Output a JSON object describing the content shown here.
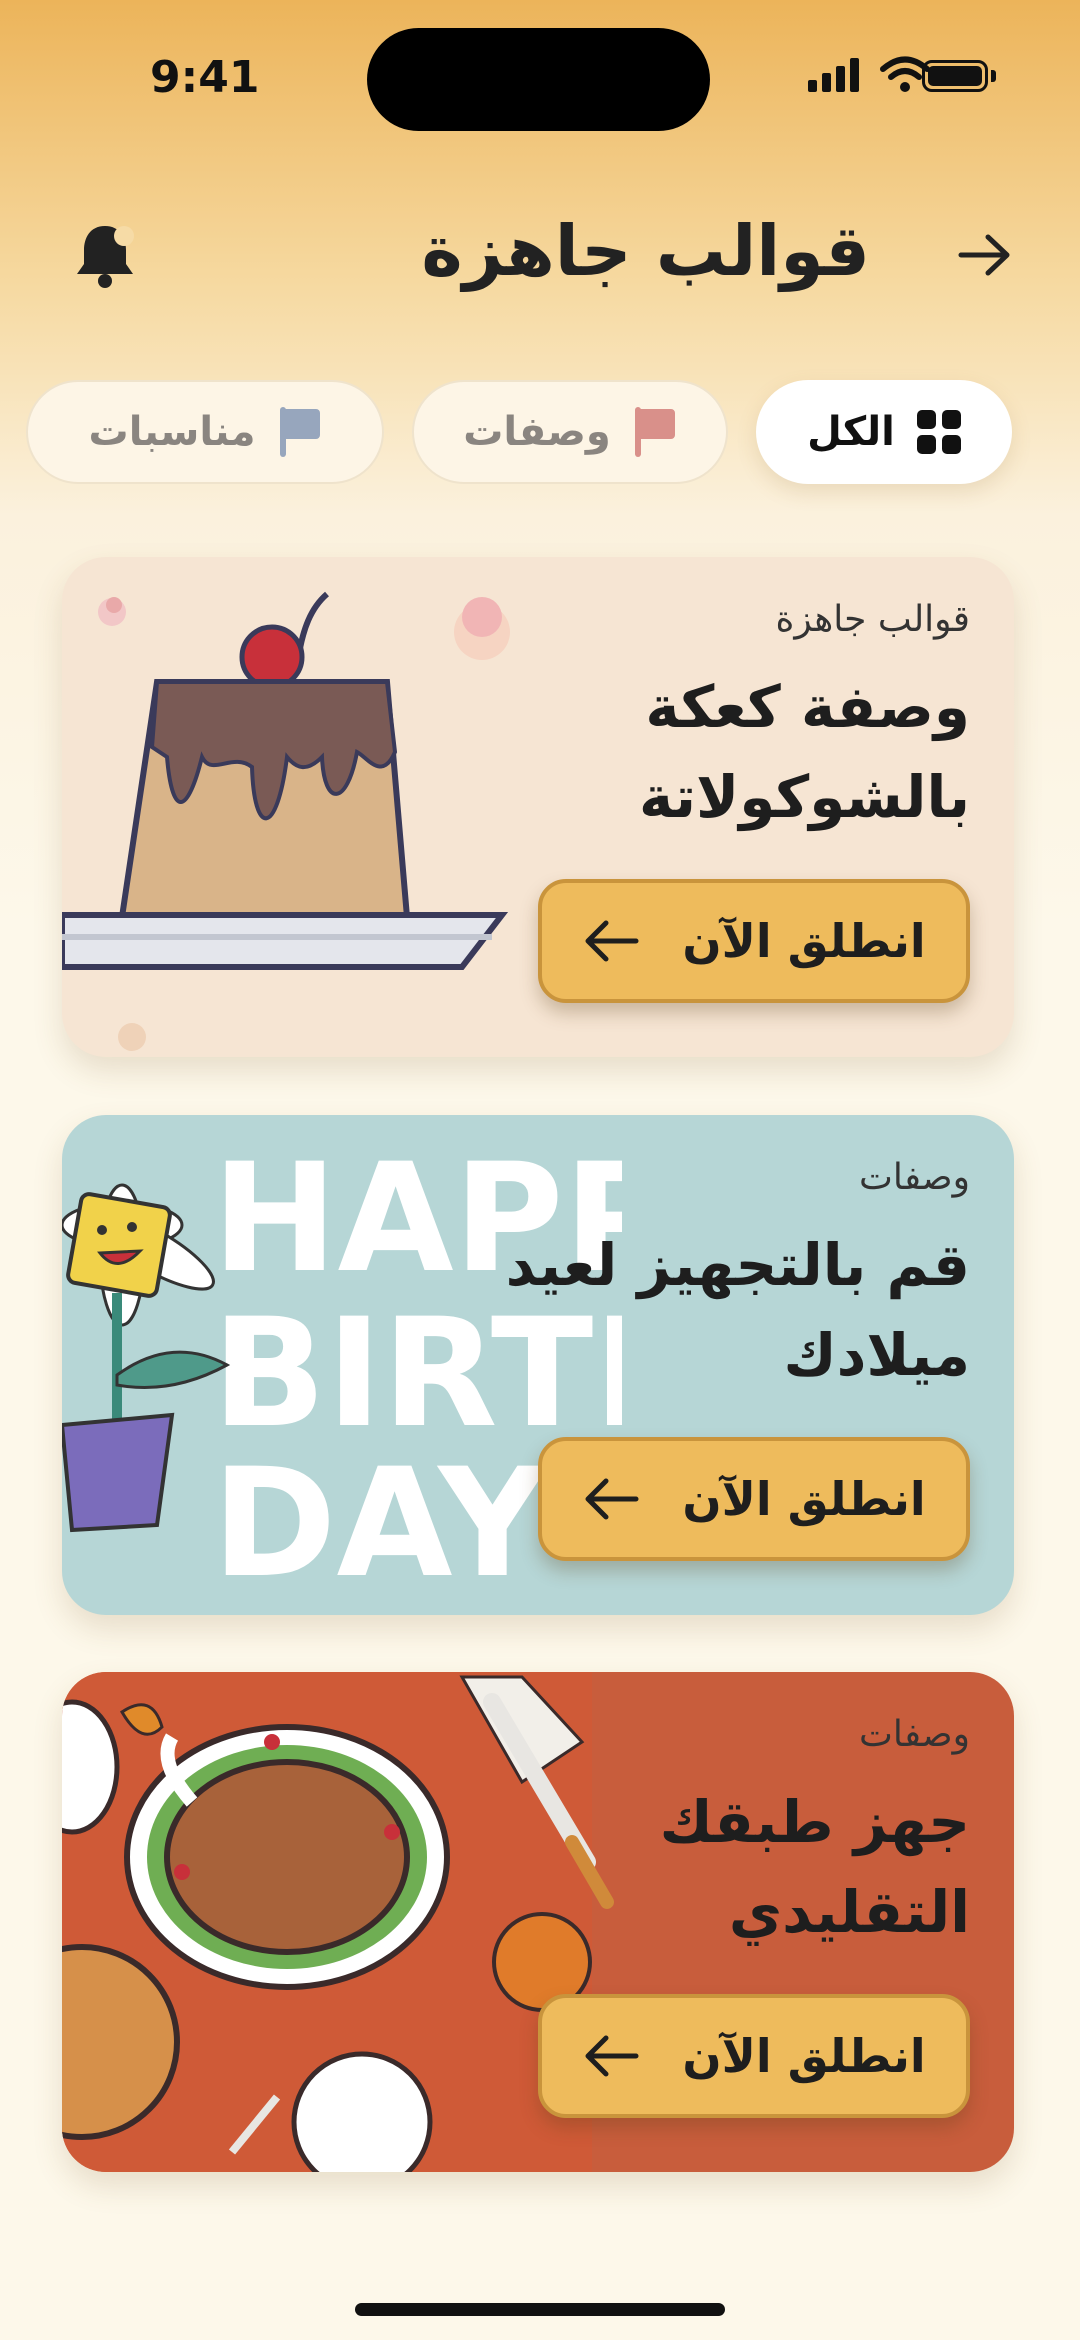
{
  "status": {
    "time": "9:41"
  },
  "header": {
    "title": "قوالب جاهزة",
    "back_icon": "arrow-right-icon",
    "bell_icon": "bell-icon"
  },
  "filters": [
    {
      "label": "الكل",
      "icon": "grid-icon",
      "selected": true
    },
    {
      "label": "وصفات",
      "icon": "flag-icon",
      "color": "#d9908a",
      "selected": false
    },
    {
      "label": "مناسبات",
      "icon": "flag-icon",
      "color": "#97a6bd",
      "selected": false
    }
  ],
  "cards": [
    {
      "label": "قوالب جاهزة",
      "title": "وصفة كعكة بالشوكولاتة",
      "button": "انطلق الآن",
      "bg": "#f6e5d3"
    },
    {
      "label": "وصفات",
      "title": "قم بالتجهيز لعيد ميلادك",
      "button": "انطلق الآن",
      "bg": "#b6d6d6",
      "art_text": [
        "HAPPY",
        "BIRTH",
        "DAY"
      ]
    },
    {
      "label": "وصفات",
      "title": "جهز طبقك التقليدي",
      "button": "انطلق الآن",
      "bg": "#c85d3c"
    }
  ],
  "colors": {
    "accent": "#eebb5c",
    "background": "#fdf8ea"
  }
}
